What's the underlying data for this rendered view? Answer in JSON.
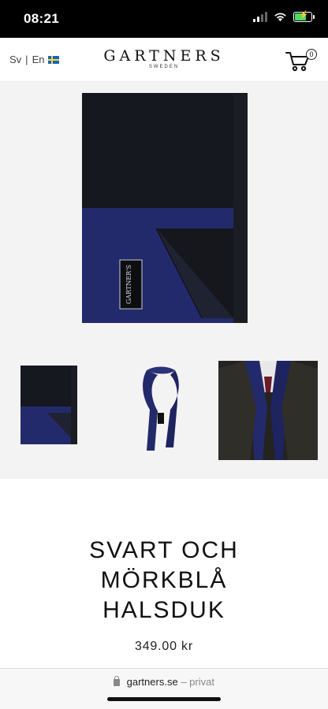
{
  "status_bar": {
    "time": "08:21"
  },
  "header": {
    "lang_sv": "Sv",
    "lang_divider": "|",
    "lang_en": "En",
    "logo": "GARTNERS",
    "logo_sub": "SWEDEN",
    "cart_count": "0"
  },
  "gallery": {
    "main_label": "GARTNER'S",
    "colors": {
      "navy": "#232a6b",
      "black": "#161820",
      "background": "#f3f3f3"
    }
  },
  "product": {
    "title_lines": [
      "SVART OCH",
      "MÖRKBLÅ",
      "HALSDUK"
    ],
    "price": "349.00 kr"
  },
  "browser": {
    "domain": "gartners.se",
    "separator": "–",
    "mode": "privat"
  }
}
